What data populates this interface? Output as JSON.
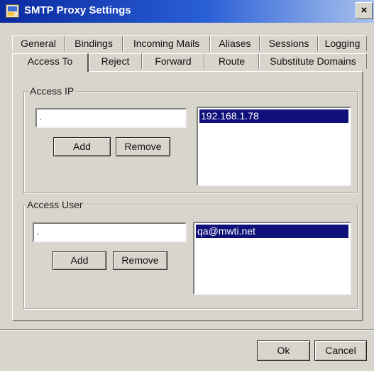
{
  "window": {
    "title": "SMTP Proxy Settings",
    "close_label": "×"
  },
  "tabs_row1": [
    "General",
    "Bindings",
    "Incoming Mails",
    "Aliases",
    "Sessions",
    "Logging"
  ],
  "tabs_row2": [
    "Access To",
    "Reject",
    "Forward",
    "Route",
    "Substitute Domains"
  ],
  "active_tab": "Access To",
  "access_ip": {
    "legend": "Access IP",
    "input_value": ".",
    "add_label": "Add",
    "remove_label": "Remove",
    "list_items": [
      "192.168.1.78"
    ]
  },
  "access_user": {
    "legend": "Access User",
    "input_value": ".",
    "add_label": "Add",
    "remove_label": "Remove",
    "list_items": [
      "qa@mwti.net"
    ]
  },
  "footer": {
    "ok_label": "Ok",
    "cancel_label": "Cancel"
  }
}
